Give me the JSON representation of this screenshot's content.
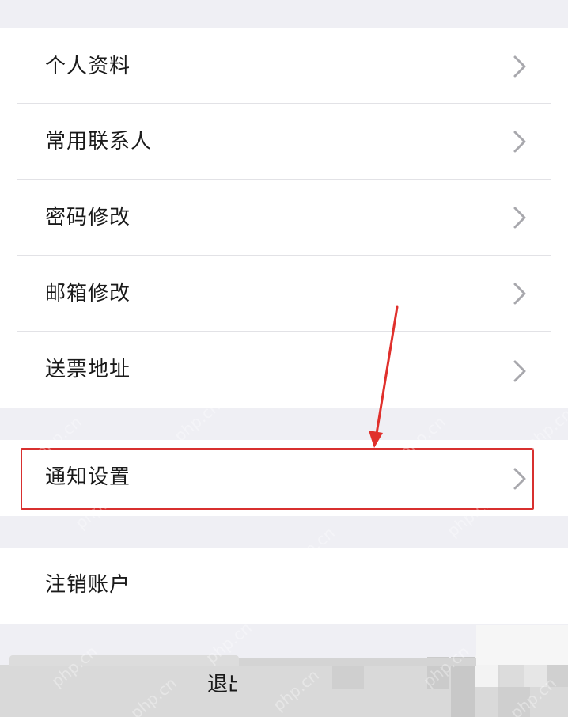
{
  "menu_group_1": {
    "items": [
      {
        "label": "个人资料",
        "icon": "chevron-right-icon"
      },
      {
        "label": "常用联系人",
        "icon": "chevron-right-icon"
      },
      {
        "label": "密码修改",
        "icon": "chevron-right-icon"
      },
      {
        "label": "邮箱修改",
        "icon": "chevron-right-icon"
      },
      {
        "label": "送票地址",
        "icon": "chevron-right-icon"
      }
    ]
  },
  "menu_group_2": {
    "items": [
      {
        "label": "通知设置",
        "icon": "chevron-right-icon"
      }
    ]
  },
  "menu_group_3": {
    "items": [
      {
        "label": "注销账户"
      }
    ]
  },
  "bottom": {
    "logout_label": "退出"
  },
  "watermark": "php.cn",
  "colors": {
    "background": "#efeff4",
    "row": "#ffffff",
    "highlight": "#d8302f",
    "chevron": "#a8a8ad"
  }
}
